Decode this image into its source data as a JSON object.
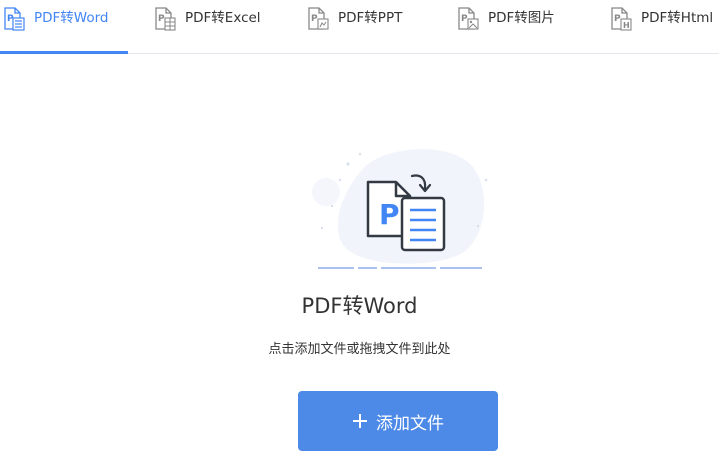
{
  "tabs": [
    {
      "label": "PDF转Word",
      "icon": "pdf-to-word-icon",
      "active": true
    },
    {
      "label": "PDF转Excel",
      "icon": "pdf-to-excel-icon",
      "active": false
    },
    {
      "label": "PDF转PPT",
      "icon": "pdf-to-ppt-icon",
      "active": false
    },
    {
      "label": "PDF转图片",
      "icon": "pdf-to-image-icon",
      "active": false
    },
    {
      "label": "PDF转Html",
      "icon": "pdf-to-html-icon",
      "active": false
    }
  ],
  "main": {
    "title": "PDF转Word",
    "hint": "点击添加文件或拖拽文件到此处",
    "add_button": "添加文件",
    "illustration_icon": "pdf-to-word-convert-icon"
  },
  "colors": {
    "accent": "#4285f4",
    "button": "#4d8ae8",
    "text": "#333333",
    "divider": "#e4e7ec"
  }
}
